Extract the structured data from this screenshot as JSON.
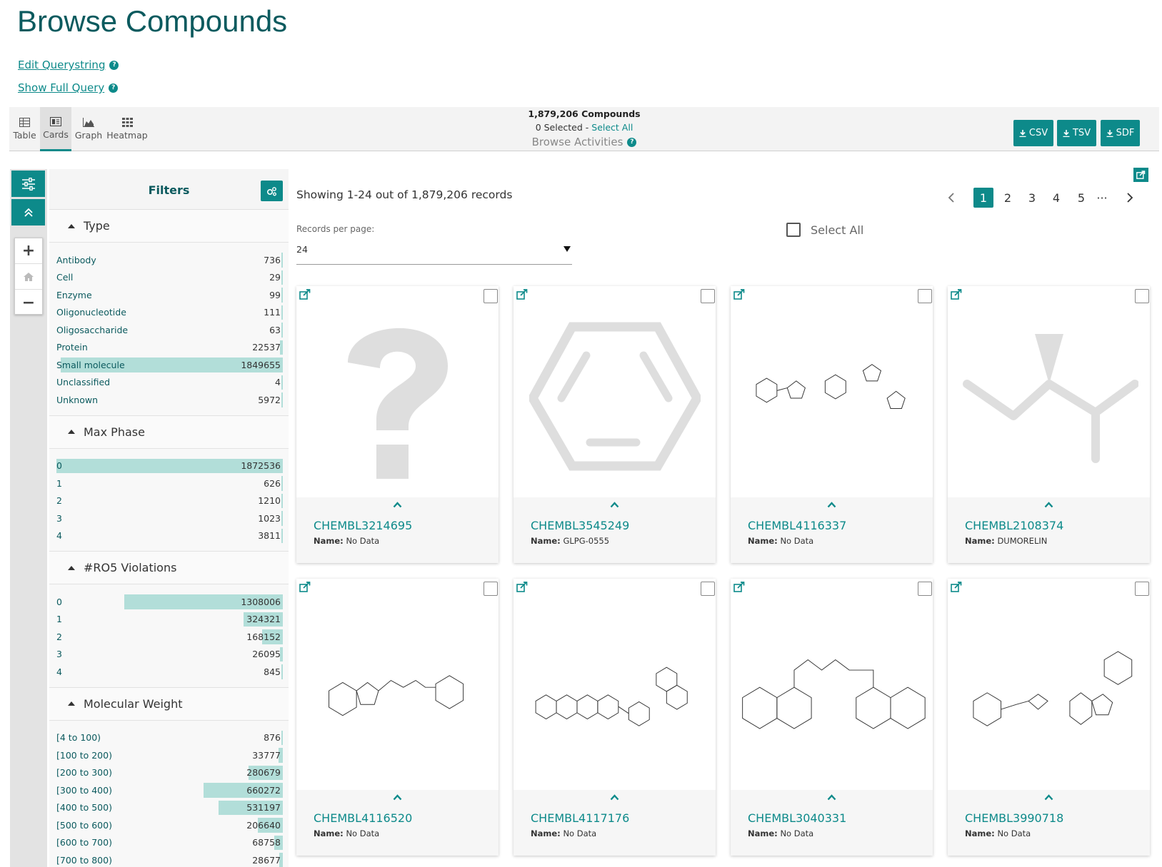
{
  "header": {
    "title": "Browse Compounds",
    "edit_querystring": "Edit Querystring",
    "show_full_query": "Show Full Query"
  },
  "toolbar": {
    "views": [
      {
        "label": "Table",
        "icon": "table-icon"
      },
      {
        "label": "Cards",
        "icon": "cards-icon",
        "active": true
      },
      {
        "label": "Graph",
        "icon": "graph-icon"
      },
      {
        "label": "Heatmap",
        "icon": "heatmap-icon"
      }
    ],
    "compound_count": "1,879,206 Compounds",
    "selected": "0 Selected - ",
    "select_all": "Select All",
    "browse_activities": "Browse Activities",
    "downloads": [
      "CSV",
      "TSV",
      "SDF"
    ]
  },
  "filters": {
    "title": "Filters",
    "sections": [
      {
        "title": "Type",
        "rows": [
          {
            "label": "Antibody",
            "count": "736",
            "frac": 0.005
          },
          {
            "label": "Cell",
            "count": "29",
            "frac": 0.005
          },
          {
            "label": "Enzyme",
            "count": "99",
            "frac": 0.005
          },
          {
            "label": "Oligonucleotide",
            "count": "111",
            "frac": 0.005
          },
          {
            "label": "Oligosaccharide",
            "count": "63",
            "frac": 0.005
          },
          {
            "label": "Protein",
            "count": "22537",
            "frac": 0.012
          },
          {
            "label": "Small molecule",
            "count": "1849655",
            "frac": 0.98
          },
          {
            "label": "Unclassified",
            "count": "4",
            "frac": 0.005
          },
          {
            "label": "Unknown",
            "count": "5972",
            "frac": 0.005
          }
        ]
      },
      {
        "title": "Max Phase",
        "rows": [
          {
            "label": "0",
            "count": "1872536",
            "frac": 1.0
          },
          {
            "label": "1",
            "count": "626",
            "frac": 0.005
          },
          {
            "label": "2",
            "count": "1210",
            "frac": 0.005
          },
          {
            "label": "3",
            "count": "1023",
            "frac": 0.005
          },
          {
            "label": "4",
            "count": "3811",
            "frac": 0.005
          }
        ]
      },
      {
        "title": "#RO5 Violations",
        "rows": [
          {
            "label": "0",
            "count": "1308006",
            "frac": 0.7
          },
          {
            "label": "1",
            "count": "324321",
            "frac": 0.175
          },
          {
            "label": "2",
            "count": "168152",
            "frac": 0.09
          },
          {
            "label": "3",
            "count": "26095",
            "frac": 0.014
          },
          {
            "label": "4",
            "count": "845",
            "frac": 0.005
          }
        ]
      },
      {
        "title": "Molecular Weight",
        "rows": [
          {
            "label": "[4 to 100)",
            "count": "876",
            "frac": 0.005
          },
          {
            "label": "[100 to 200)",
            "count": "33777",
            "frac": 0.018
          },
          {
            "label": "[200 to 300)",
            "count": "280679",
            "frac": 0.15
          },
          {
            "label": "[300 to 400)",
            "count": "660272",
            "frac": 0.35
          },
          {
            "label": "[400 to 500)",
            "count": "531197",
            "frac": 0.285
          },
          {
            "label": "[500 to 600)",
            "count": "206640",
            "frac": 0.11
          },
          {
            "label": "[600 to 700)",
            "count": "68758",
            "frac": 0.037
          },
          {
            "label": "[700 to 800)",
            "count": "28677",
            "frac": 0.015
          }
        ]
      }
    ]
  },
  "results": {
    "showing": "Showing 1-24 out of 1,879,206 records",
    "records_per_page_label": "Records per page:",
    "records_per_page_value": "24",
    "select_all": "Select All",
    "pages": [
      "1",
      "2",
      "3",
      "4",
      "5",
      "···"
    ],
    "current_page": "1"
  },
  "cards": [
    {
      "id": "CHEMBL3214695",
      "name_label": "Name:",
      "name": "No Data",
      "image": "unknown-structure"
    },
    {
      "id": "CHEMBL3545249",
      "name_label": "Name:",
      "name": "GLPG-0555",
      "image": "generic-benzene"
    },
    {
      "id": "CHEMBL4116337",
      "name_label": "Name:",
      "name": "No Data",
      "image": "structure"
    },
    {
      "id": "CHEMBL2108374",
      "name_label": "Name:",
      "name": "DUMORELIN",
      "image": "generic-branch"
    },
    {
      "id": "CHEMBL4116520",
      "name_label": "Name:",
      "name": "No Data",
      "image": "structure"
    },
    {
      "id": "CHEMBL4117176",
      "name_label": "Name:",
      "name": "No Data",
      "image": "structure"
    },
    {
      "id": "CHEMBL3040331",
      "name_label": "Name:",
      "name": "No Data",
      "image": "structure"
    },
    {
      "id": "CHEMBL3990718",
      "name_label": "Name:",
      "name": "No Data",
      "image": "structure"
    }
  ],
  "colors": {
    "accent": "#0d8a8a",
    "title": "#0b5a5e",
    "bar": "#b2ded9"
  }
}
